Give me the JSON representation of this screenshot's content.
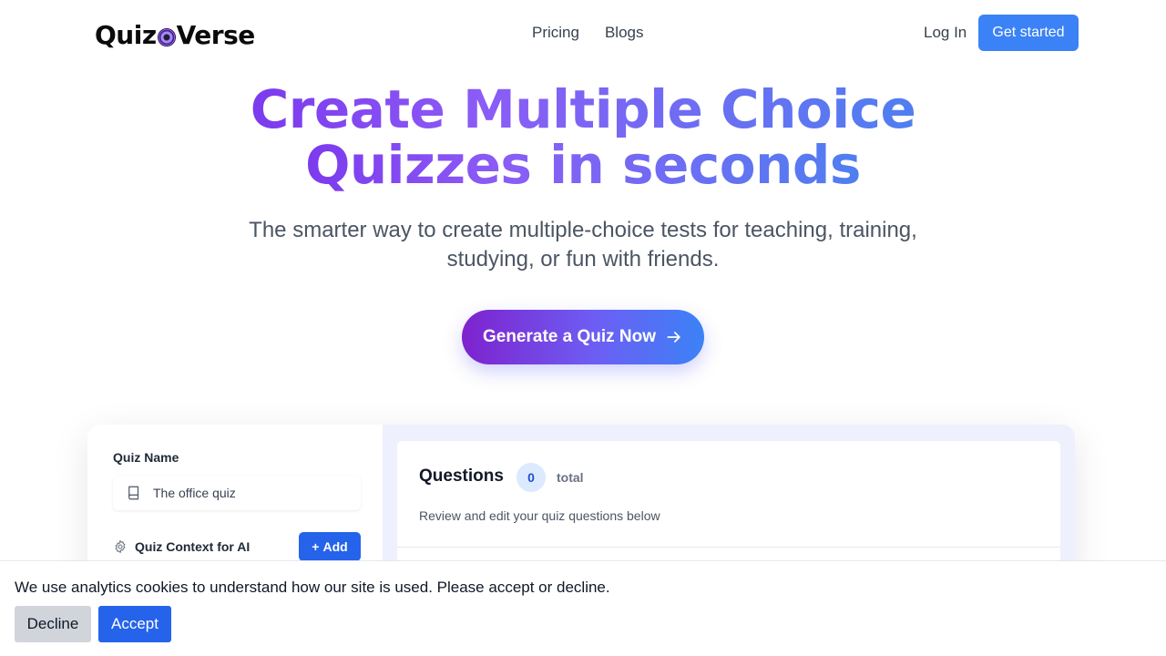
{
  "header": {
    "logo_left": "Quiz",
    "logo_right": "Verse",
    "nav": [
      {
        "label": "Pricing"
      },
      {
        "label": "Blogs"
      }
    ],
    "login_label": "Log In",
    "get_started_label": "Get started"
  },
  "hero": {
    "title_line1": "Create Multiple Choice",
    "title_line2": "Quizzes in seconds",
    "subtitle_line1": "The smarter way to create multiple-choice tests for teaching, training,",
    "subtitle_line2": "studying, or fun with friends.",
    "cta_label": "Generate a Quiz Now",
    "gradient_colors": [
      "#7c3aed",
      "#3b82f6"
    ]
  },
  "preview": {
    "quiz_name_label": "Quiz Name",
    "quiz_name_value": "The office quiz",
    "context_label": "Quiz Context for AI",
    "add_label": "Add",
    "questions_title": "Questions",
    "questions_count": "0",
    "questions_total_label": "total",
    "questions_description": "Review and edit your quiz questions below"
  },
  "cookie_banner": {
    "message": "We use analytics cookies to understand how our site is used. Please accept or decline.",
    "decline_label": "Decline",
    "accept_label": "Accept"
  },
  "colors": {
    "primary": "#3b82f6",
    "accent_blue": "#2563eb",
    "purple": "#7c3aed"
  },
  "icons": [
    "logo-mark-icon",
    "arrow-right-icon",
    "book-icon",
    "gear-icon",
    "plus-icon"
  ]
}
